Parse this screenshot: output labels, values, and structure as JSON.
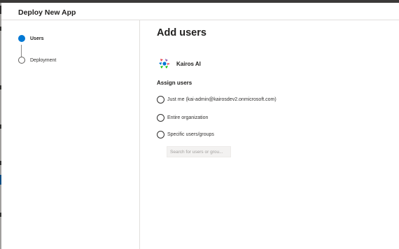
{
  "window": {
    "title": "Deploy New App"
  },
  "steps": [
    {
      "label": "Users",
      "state": "active"
    },
    {
      "label": "Deployment",
      "state": "pending"
    }
  ],
  "main": {
    "title": "Add users",
    "app": {
      "name": "Kairos AI",
      "icon": "kairos-logo-icon"
    },
    "assign": {
      "title": "Assign users",
      "options": [
        {
          "label": "Just me (kai-admin@kairosdev2.onmicrosoft.com)",
          "selected": false
        },
        {
          "label": "Entire organization",
          "selected": false
        },
        {
          "label": "Specific users/groups",
          "selected": false
        }
      ],
      "search_placeholder": "Search for users or grou..."
    }
  },
  "colors": {
    "accent": "#0078d4",
    "logo_red": "#e74856",
    "logo_blue": "#0078d4",
    "logo_green": "#16c60c",
    "logo_purple": "#8764b8"
  }
}
